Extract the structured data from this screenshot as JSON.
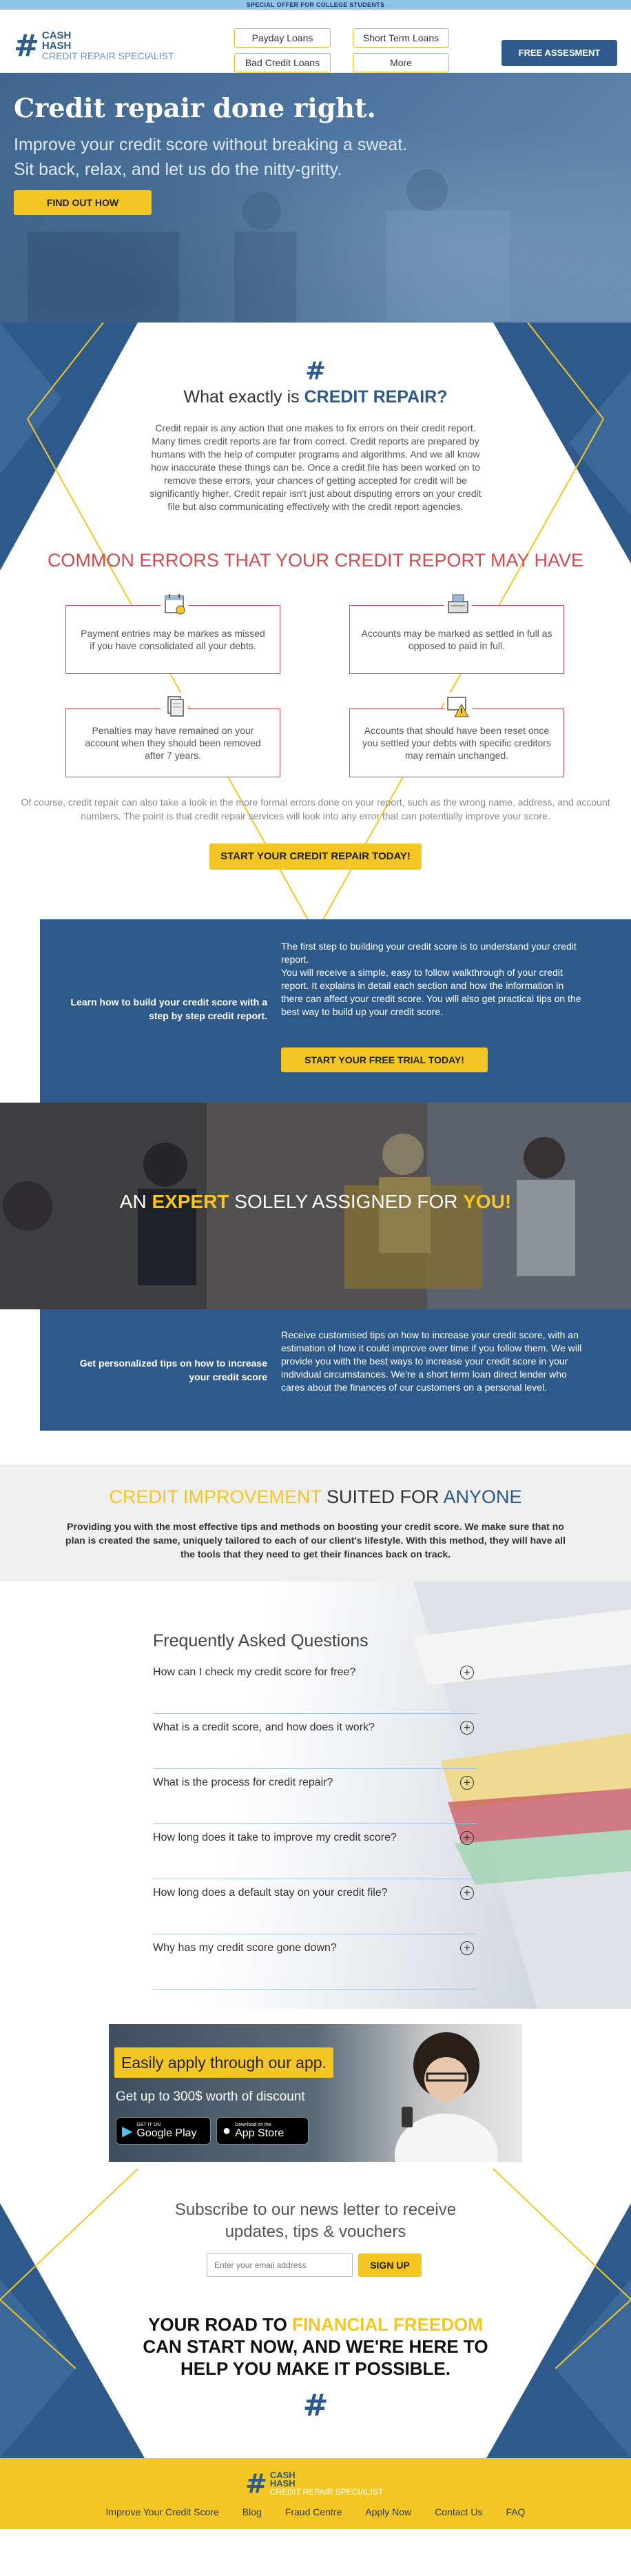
{
  "topbar": {
    "text": "SPECIAL OFFER FOR COLLEGE STUDENTS"
  },
  "brand": {
    "symbol": "#",
    "line1": "CASH",
    "line2": "HASH",
    "line3": "CREDIT REPAIR SPECIALIST"
  },
  "nav": {
    "items": [
      "Payday Loans",
      "Short Term Loans",
      "Bad Credit Loans",
      "More"
    ],
    "cta": "FREE ASSESMENT"
  },
  "hero": {
    "title": "Credit repair done right.",
    "subtitle_1": "Improve your credit score without breaking a sweat.",
    "subtitle_2": "Sit back, relax, and let us do the nitty-gritty.",
    "button": "FIND OUT HOW"
  },
  "what_is": {
    "symbol": "#",
    "heading_prefix": "What exactly is",
    "heading_highlight": "CREDIT REPAIR?",
    "paragraph": "Credit repair is any action that one makes to fix errors on their credit report. Many times credit reports are far from correct. Credit reports are prepared by humans with the help of computer programs and algorithms. And we all know how inaccurate these things can be. Once a credit file has been worked on to remove these errors, your chances of getting accepted for credit will be significantly higher. Credit repair isn't just about disputing errors on your credit file but also communicating effectively with the credit report agencies."
  },
  "errors": {
    "heading": "COMMON ERRORS THAT YOUR CREDIT REPORT MAY HAVE",
    "items": [
      {
        "text": "Payment entries may be markes as missed if you have consolidated all your debts.",
        "icon": "calendar-icon"
      },
      {
        "text": "Accounts may be marked as settled in full as opposed to paid in full.",
        "icon": "cash-register-icon"
      },
      {
        "text": "Penalties may have remained on your account when they should been removed after 7 years.",
        "icon": "documents-icon"
      },
      {
        "text": "Accounts that should have been reset once you settled your debts with specific creditors may remain unchanged.",
        "icon": "warning-card-icon"
      }
    ],
    "footer_text": "Of course, credit repair can also take a look in the more formal errors done on your report, such as the wrong name, address, and account numbers. The point is that credit repair services will look into any error that can potentially improve your score.",
    "button": "START YOUR CREDIT REPAIR TODAY!"
  },
  "learn": {
    "left": "Learn how to build your credit score with a step by step credit report.",
    "right_1": "The first step to building your credit score is to understand your credit report.",
    "right_2": "You will receive a simple, easy to follow walkthrough of your credit report. It explains in detail each section and how the information in there can affect your credit score. You will also get practical tips on the best way to build up your credit score.",
    "button": "START YOUR FREE TRIAL TODAY!"
  },
  "expert": {
    "prefix": "AN",
    "highlight": "EXPERT",
    "middle": "SOLELY ASSIGNED FOR",
    "highlight_2": "YOU!"
  },
  "tips": {
    "left": "Get personalized tips on how to increase your credit score",
    "right": "Receive customised tips on how to increase your credit score, with an estimation of how it could improve over time if you follow them. We will provide you with the best ways to increase your credit score in your individual circumstances. We're a short term loan direct lender who cares about the finances of our customers on a personal level."
  },
  "improvement": {
    "highlight": "CREDIT IMPROVEMENT",
    "middle": "SUITED FOR",
    "end": "ANYONE",
    "paragraph": "Providing you with the most effective tips and methods on boosting your credit score. We make sure that no plan is created the same, uniquely tailored to each of our client's lifestyle. With this method, they will have all the tools that they need to get their finances back on track."
  },
  "faq": {
    "title": "Frequently Asked Questions",
    "questions": [
      "How can I check my credit score for free?",
      "What is a credit score, and how does it work?",
      "What is the process for credit repair?",
      "How long does it take to improve my credit score?",
      "How long does a default stay on your credit file?",
      "Why has my credit score gone down?"
    ],
    "toggle_symbol": "+"
  },
  "app": {
    "tagline": "Easily apply through our app.",
    "discount": "Get up to 300$ worth of discount",
    "google_small": "GET IT ON",
    "google_big": "Google Play",
    "apple_small": "Download on the",
    "apple_big": "App Store"
  },
  "newsletter": {
    "line1": "Subscribe to our news letter to receive",
    "line2": "updates, tips & vouchers",
    "placeholder": "Enter your email address",
    "button": "SIGN UP"
  },
  "road": {
    "l1a": "YOUR ROAD TO",
    "l1b": "FINANCIAL FREEDOM",
    "l2": "CAN START NOW, AND WE'RE HERE TO",
    "l3": "HELP YOU MAKE IT POSSIBLE.",
    "symbol": "#"
  },
  "footer": {
    "links": [
      "Improve Your Credit Score",
      "Blog",
      "Fraud Centre",
      "Apply Now",
      "Contact Us",
      "FAQ"
    ]
  },
  "colors": {
    "brand_blue": "#2d5a8a",
    "accent_yellow": "#f3c623",
    "error_red": "#d04c50"
  }
}
